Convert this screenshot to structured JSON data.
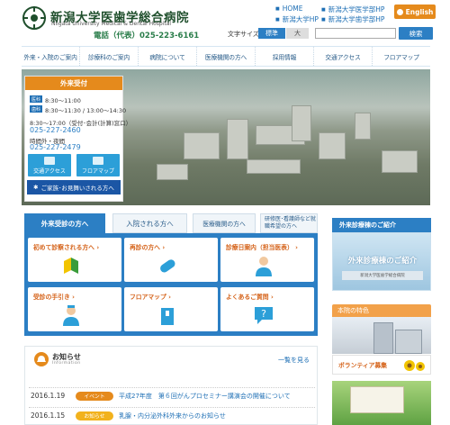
{
  "header": {
    "name": "新潟大学医歯学総合病院",
    "name_en": "Niigata University Medical & Dental Hospital",
    "tel": "電話（代表）025-223-6161",
    "links": [
      "HOME",
      "新潟大学医学部HP",
      "新潟大学HP",
      "新潟大学歯学部HP"
    ],
    "english": "English",
    "font_size_label": "文字サイズ",
    "font_std": "標準",
    "font_large": "大",
    "search_placeholder": "",
    "search_label": "検索"
  },
  "nav": [
    "外来・入院のご案内",
    "診療科のご案内",
    "病院について",
    "医療機関の方へ",
    "採用情報",
    "交通アクセス",
    "フロアマップ"
  ],
  "outpatient": {
    "title": "外来受付",
    "tag_med": "医科",
    "time_med": "8:30〜11:00",
    "tag_dent": "歯科",
    "time_dent": "8:30〜11:30 / 13:00〜14:30",
    "note": "8:30〜17:00（受付･会計(計算)窓口）",
    "phone1": "025-227-2460",
    "night": "時間外・夜間",
    "phone2": "025-227-2479",
    "access": "交通アクセス",
    "floormap": "フロアマップ",
    "visitor": "ご家族･お見舞いされる方へ"
  },
  "tabs": [
    "外来受診の方へ",
    "入院される方へ",
    "医療機関の方へ",
    "研修医･看護師など就職希望の方へ"
  ],
  "cards": [
    "初めて診察される方へ",
    "再診の方へ",
    "診療日案内（担当医表）",
    "受診の手引き",
    "フロアマップ",
    "よくあるご質問"
  ],
  "news": {
    "title": "お知らせ",
    "subtitle": "Information",
    "more": "一覧を見る",
    "items": [
      {
        "date": "2016.1.19",
        "cat": "イベント",
        "title": "平成27年度　第６回がんプロセミナー講演会の開催について"
      },
      {
        "date": "2016.1.15",
        "cat": "お知らせ",
        "title": "乳腺・内分泌外科外来からのお知らせ"
      }
    ]
  },
  "right": {
    "head1": "外来診療棟のご紹介",
    "img1_text": "外来診療棟のご紹介",
    "img1_sign": "新潟大学医歯学総合病院",
    "head2": "本院の特色",
    "volunteer": "ボランティア募集"
  },
  "colors": {
    "accent": "#2c7fc4",
    "orange": "#e58a1c",
    "green": "#1f4f2c"
  }
}
